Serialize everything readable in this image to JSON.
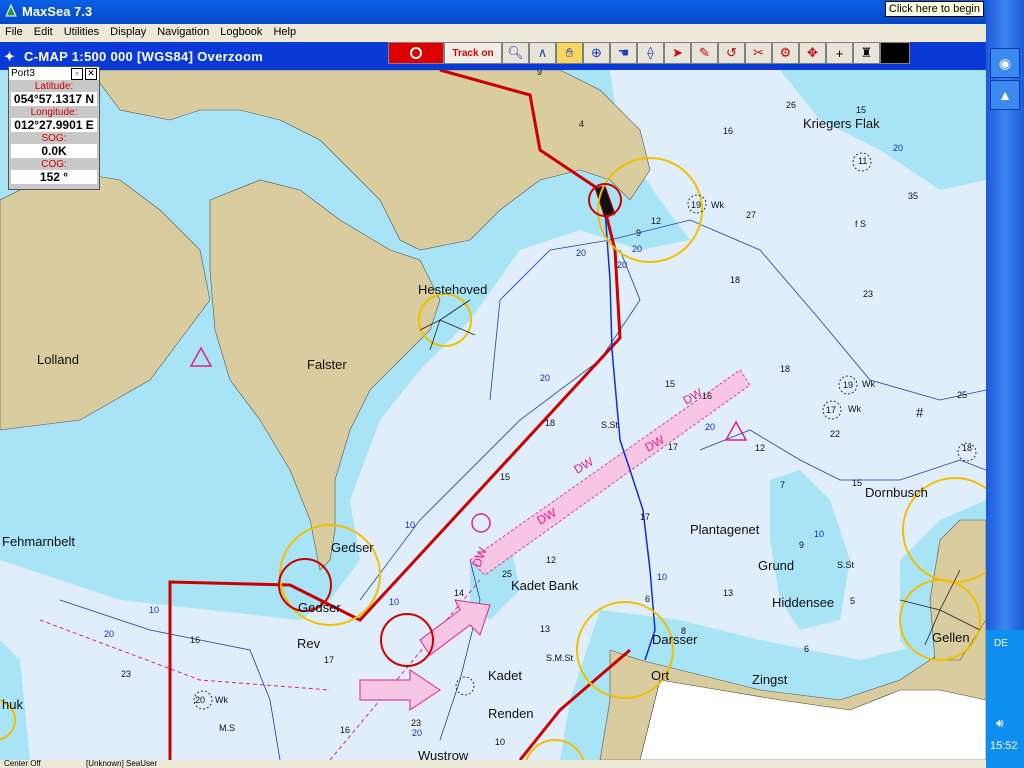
{
  "window": {
    "title": "MaxSea 7.3",
    "click_hint": "Click here to begin"
  },
  "menu": [
    "File",
    "Edit",
    "Utilities",
    "Display",
    "Navigation",
    "Logbook",
    "Help"
  ],
  "chart_header": {
    "text": "C-MAP  1:500 000 [WGS84]   Overzoom"
  },
  "toolbar": {
    "track_label": "Track on"
  },
  "port_panel": {
    "title": "Port3",
    "latitude_label": "Latitude:",
    "latitude": "054°57.1317 N",
    "longitude_label": "Longitude:",
    "longitude": "012°27.9901 E",
    "sog_label": "SOG:",
    "sog": "0.0K",
    "cog_label": "COG:",
    "cog": "152 °"
  },
  "map_labels": {
    "lolland": "Lolland",
    "falster": "Falster",
    "hestehoved": "Hestehoved",
    "kriegers_flak": "Kriegers Flak",
    "fehmarnbelt": "Fehmarnbelt",
    "gedser_1": "Gedser",
    "gedser_2": "Gedser",
    "rev": "Rev",
    "kadet_bank": "Kadet Bank",
    "kadet": "Kadet",
    "renden": "Renden",
    "wustrow": "Wustrow",
    "darsser": "Darsser",
    "ort": "Ort",
    "zingst": "Zingst",
    "plantagenet": "Plantagenet",
    "grund": "Grund",
    "hiddensee": "Hiddensee",
    "dornbusch": "Dornbusch",
    "gellen": "Gellen",
    "huk": "huk",
    "dw": "DW"
  },
  "depths": {
    "d9": "9",
    "d26": "26",
    "d15": "15",
    "d4": "4",
    "d16": "16",
    "d11": "11",
    "d19": "19",
    "d35": "35",
    "d27": "27",
    "d12": "12",
    "d9b": "9",
    "fs": "f S",
    "d18": "18",
    "d23": "23",
    "d15b": "15",
    "d18b": "18",
    "d19b": "19",
    "d17": "17",
    "d22": "22",
    "d25": "25",
    "d18c": "18",
    "d12b": "12",
    "d18d": "18",
    "d17b": "17",
    "d15c": "15",
    "d15d": "15",
    "d7": "7",
    "d9c": "9",
    "d13": "13",
    "d5": "5",
    "d6": "6",
    "d12c": "12",
    "d14": "14",
    "d13b": "13",
    "d16b": "16",
    "d17c": "17",
    "d23b": "23",
    "d20": "20",
    "d16c": "16",
    "d10": "10",
    "d8": "8",
    "ss": "S.St",
    "smst": "S.M.St",
    "ms": "M.S",
    "wk": "Wk",
    "c10": "10",
    "c20": "20"
  },
  "status": {
    "left": "Center Off",
    "user": "[Unknown] SeaUser"
  },
  "tray": {
    "lang": "DE",
    "time": "15:52"
  },
  "colors": {
    "water": "#dfeefa",
    "shallow": "#a8e4f6",
    "land": "#d9cc9e",
    "route": "#cc0000",
    "track": "#1030c8",
    "ring": "#f0c000",
    "magenta": "#e0208c"
  }
}
